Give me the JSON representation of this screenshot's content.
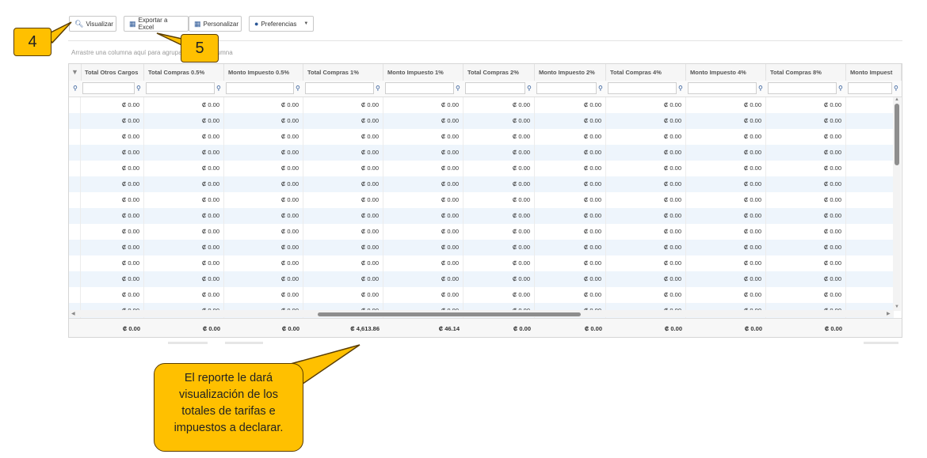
{
  "toolbar": {
    "visualizar": "Visualizar",
    "exportar": "Exportar a Excel",
    "personalizar": "Personalizar",
    "preferencias": "Preferencias"
  },
  "group_hint": "Arrastre una columna aquí para agrupar por esa columna",
  "columns": [
    "Total Otros Cargos",
    "Total Compras 0.5%",
    "Monto Impuesto 0.5%",
    "Total Compras 1%",
    "Monto Impuesto 1%",
    "Total Compras 2%",
    "Monto Impuesto 2%",
    "Total Compras 4%",
    "Monto Impuesto 4%",
    "Total Compras 8%",
    "Monto Impuest"
  ],
  "row_value": "₡ 0.00",
  "row_count": 14,
  "footer_totals": [
    "₡ 0.00",
    "₡ 0.00",
    "₡ 0.00",
    "₡ 4,613.86",
    "₡ 46.14",
    "₡ 0.00",
    "₡ 0.00",
    "₡ 0.00",
    "₡ 0.00",
    "₡ 0.00",
    ""
  ],
  "callouts": {
    "step4": "4",
    "step5": "5",
    "bubble_lines": [
      "El reporte le dará",
      "visualización de los",
      "totales de tarifas e",
      "impuestos a declarar."
    ]
  },
  "colors": {
    "accent": "#2b5797",
    "callout": "#ffc000",
    "alt_row": "#eef5fc"
  }
}
